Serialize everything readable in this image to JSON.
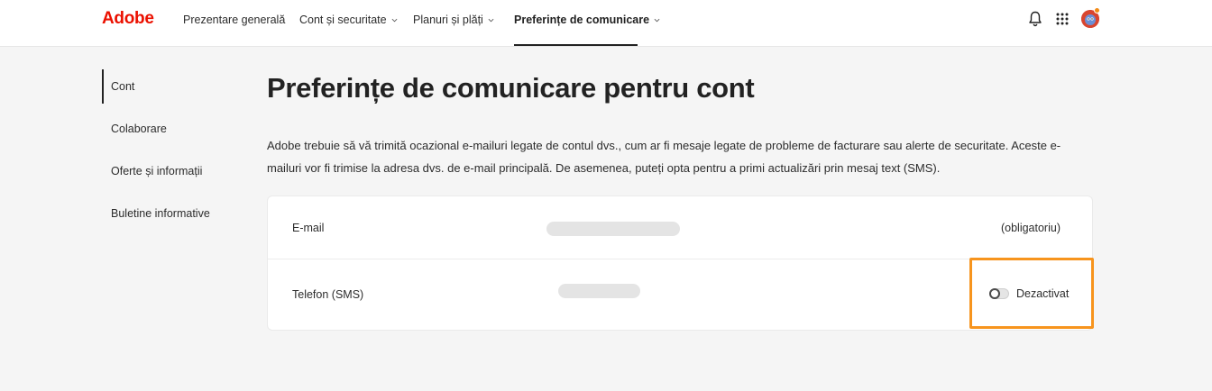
{
  "header": {
    "logo": "Adobe",
    "nav": [
      {
        "label": "Prezentare generală",
        "has_dropdown": false
      },
      {
        "label": "Cont și securitate",
        "has_dropdown": true
      },
      {
        "label": "Planuri și plăți",
        "has_dropdown": true
      },
      {
        "label": "Preferințe de comunicare",
        "has_dropdown": true,
        "active": true
      }
    ],
    "icons": [
      "bell-icon",
      "apps-grid-icon",
      "avatar"
    ],
    "brand_color": "#eb1000"
  },
  "sidebar": {
    "items": [
      {
        "label": "Cont",
        "active": true
      },
      {
        "label": "Colaborare"
      },
      {
        "label": "Oferte și informații"
      },
      {
        "label": "Buletine informative"
      }
    ]
  },
  "main": {
    "title": "Preferințe de comunicare pentru cont",
    "description": "Adobe trebuie să vă trimită ocazional e-mailuri legate de contul dvs., cum ar fi mesaje legate de probleme de facturare sau alerte de securitate. Aceste e-mailuri vor fi trimise la adresa dvs. de e-mail principală. De asemenea, puteți opta pentru a primi actualizări prin mesaj text (SMS).",
    "rows": [
      {
        "label": "E-mail",
        "status": "(obligatoriu)"
      },
      {
        "label": "Telefon (SMS)",
        "toggle_label": "Dezactivat",
        "toggle_on": false
      }
    ],
    "highlight_color": "#f7941d"
  }
}
